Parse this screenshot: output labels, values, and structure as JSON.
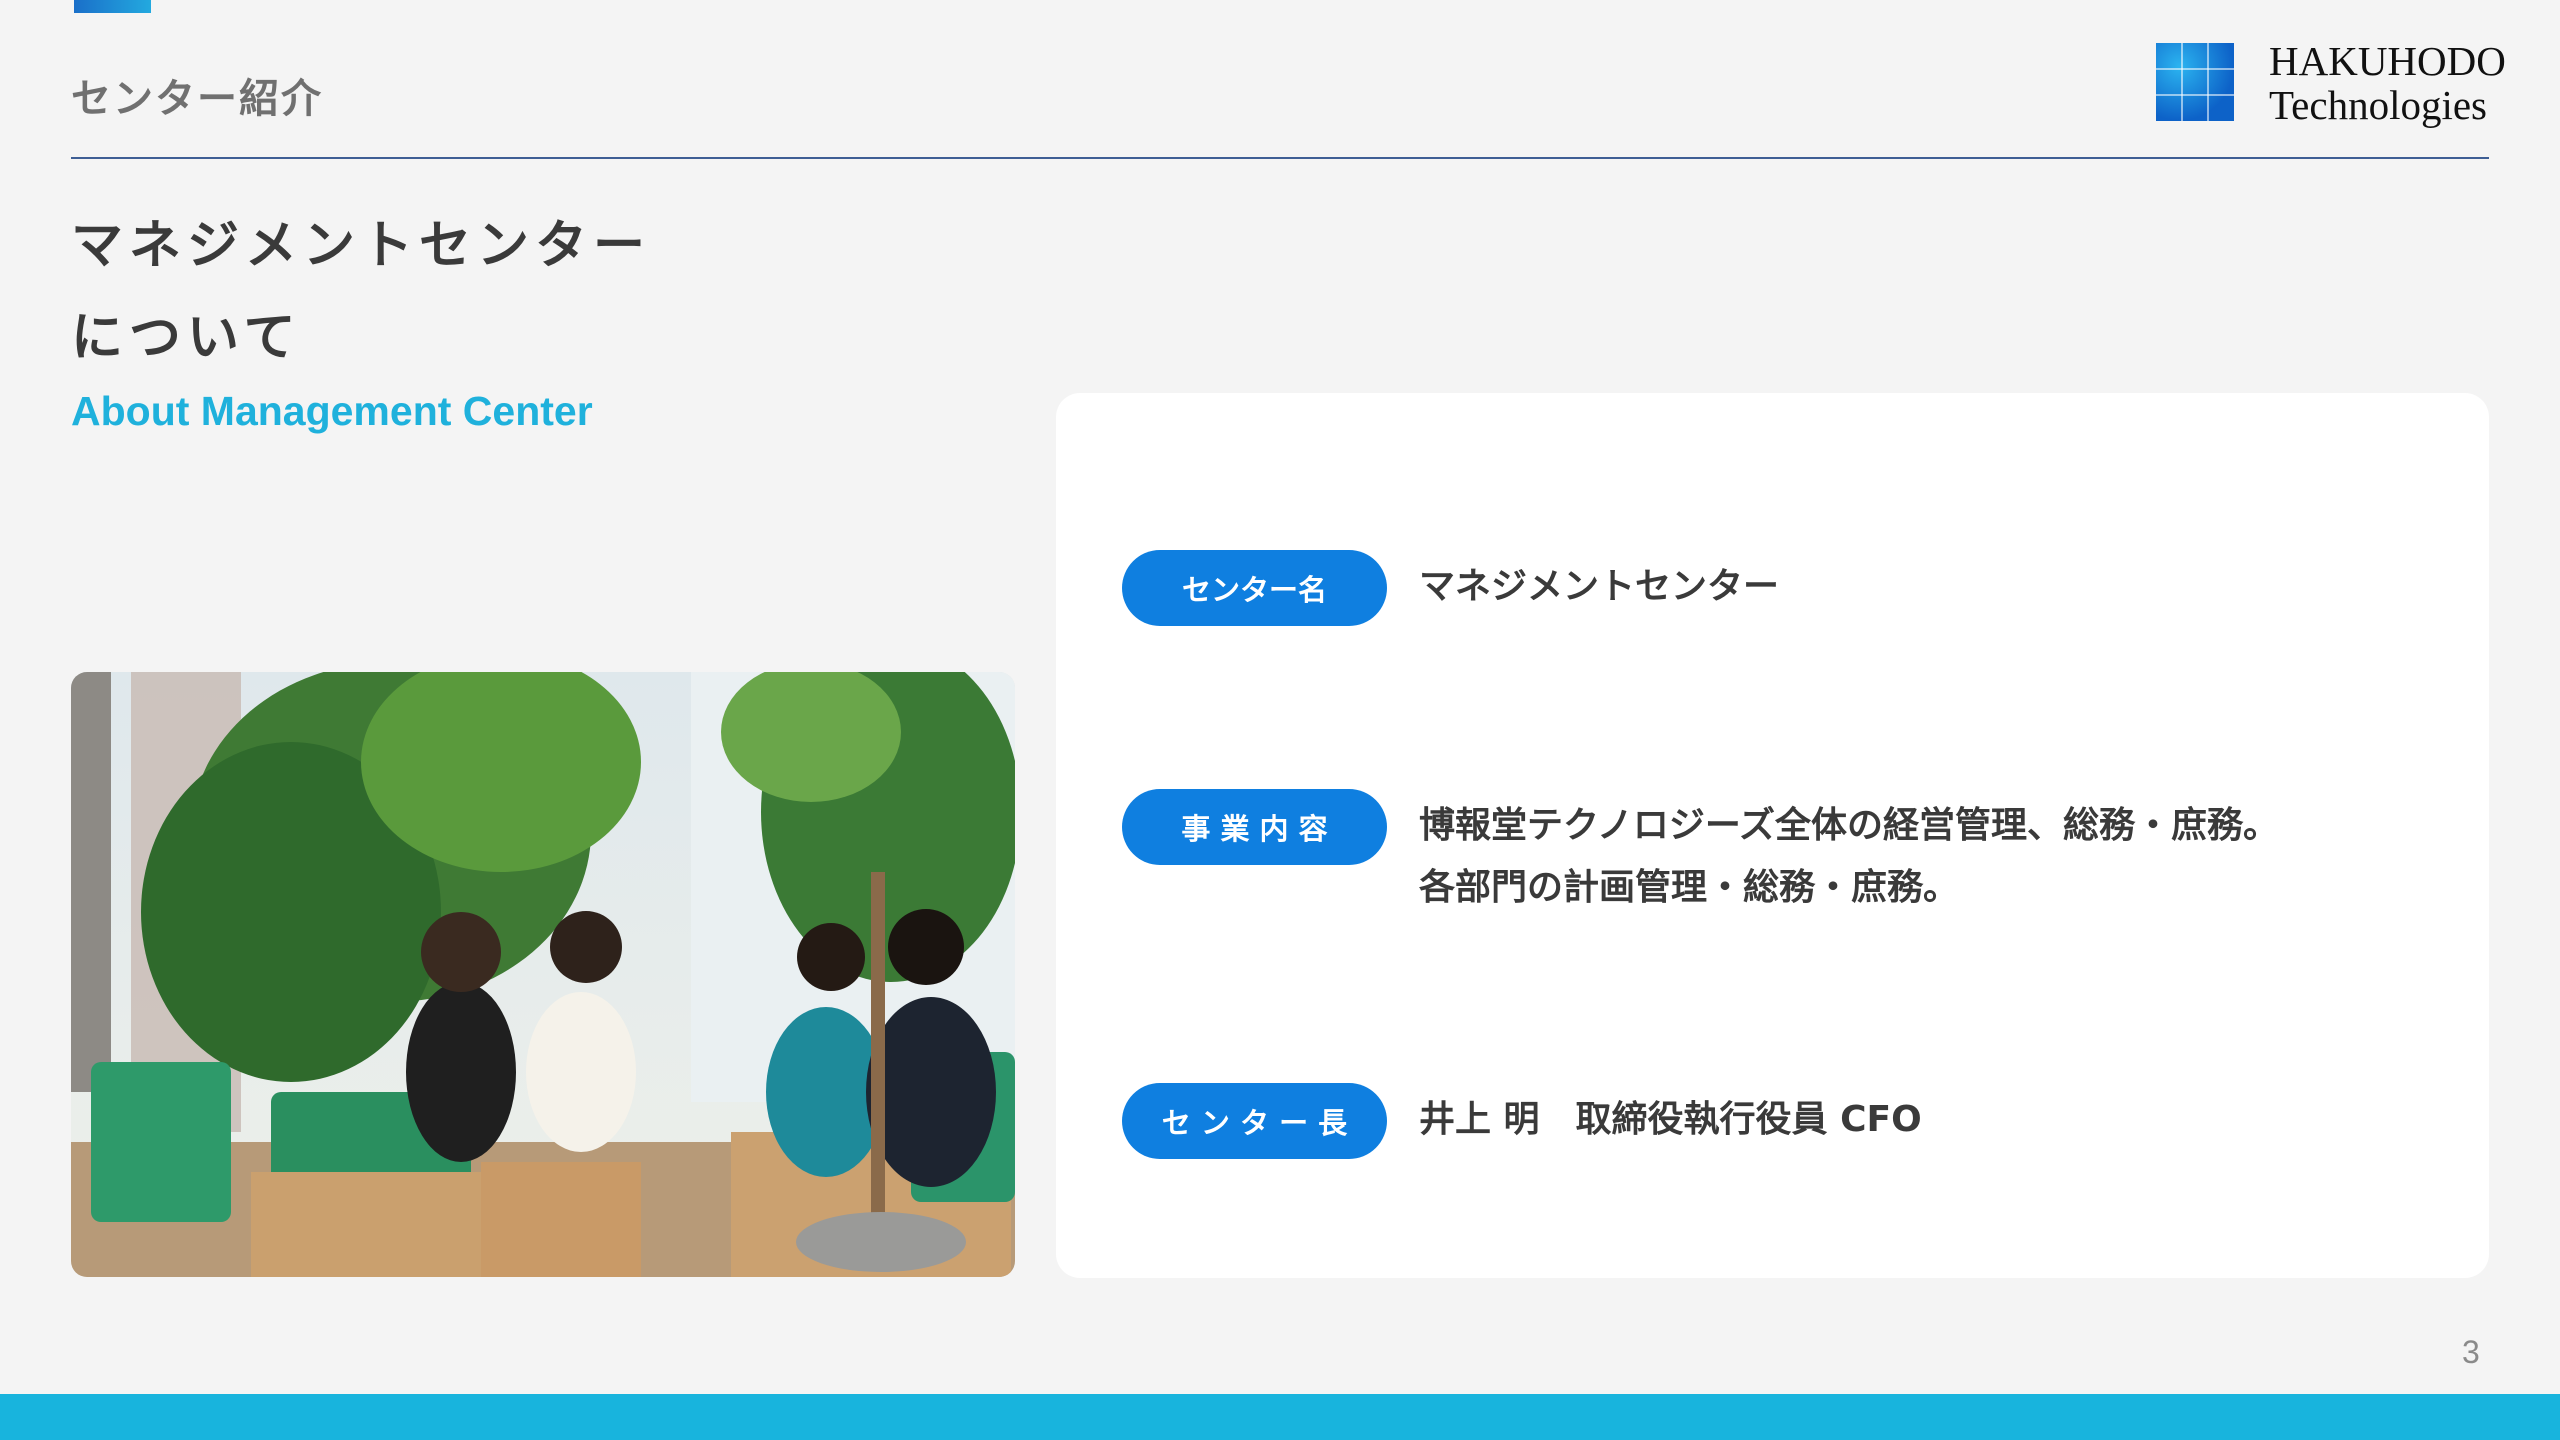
{
  "header": {
    "section_label": "センター紹介",
    "logo_line1": "HAKUHODO",
    "logo_line2": "Technologies"
  },
  "title": {
    "line1": "マネジメントセンター",
    "line2": "について",
    "subtitle": "About Management Center"
  },
  "info": {
    "rows": [
      {
        "label": "センター名",
        "value_lines": [
          "マネジメントセンター"
        ]
      },
      {
        "label": "事 業 内 容",
        "value_lines": [
          "博報堂テクノロジーズ全体の経営管理、総務・庶務。",
          "各部門の計画管理・総務・庶務。"
        ]
      },
      {
        "label": "セ ン タ ー 長",
        "value_lines": [
          "井上 明　取締役執行役員 CFO"
        ]
      }
    ]
  },
  "page_number": "3",
  "colors": {
    "accent": "#0f7fe0",
    "subtitle": "#1fb1dc",
    "bottom_bar": "#18b4dd",
    "rule": "#3e5e94"
  }
}
